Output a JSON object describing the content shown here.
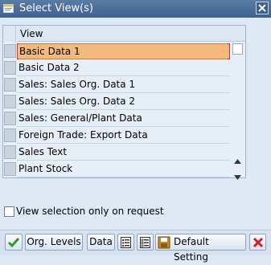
{
  "window": {
    "title": "Select View(s)"
  },
  "table": {
    "column_header": "View",
    "rows": [
      {
        "label": "Basic Data 1",
        "selected": true
      },
      {
        "label": "Basic Data 2",
        "selected": false
      },
      {
        "label": "Sales: Sales Org. Data 1",
        "selected": false
      },
      {
        "label": "Sales: Sales Org. Data 2",
        "selected": false
      },
      {
        "label": "Sales: General/Plant Data",
        "selected": false
      },
      {
        "label": "Foreign Trade: Export Data",
        "selected": false
      },
      {
        "label": "Sales Text",
        "selected": false
      },
      {
        "label": "Plant Stock",
        "selected": false
      }
    ]
  },
  "options": {
    "view_selection_label": "View selection only on request",
    "view_selection_checked": false
  },
  "toolbar": {
    "org_levels_label": "Org. Levels",
    "data_label": "Data",
    "default_setting_label": "Default Setting"
  },
  "icons": {
    "app": "window-icon",
    "close": "close-icon",
    "confirm": "checkmark-icon",
    "select_all": "select-all-icon",
    "deselect_all": "deselect-all-icon",
    "save": "save-icon",
    "cancel": "cancel-icon"
  },
  "colors": {
    "titlebar": "#3d6190",
    "background": "#dfe9f5",
    "selected_row": "#f4ba7f",
    "selection_marker": "#e03030",
    "confirm_green": "#2e9a22",
    "cancel_red": "#d02020"
  }
}
